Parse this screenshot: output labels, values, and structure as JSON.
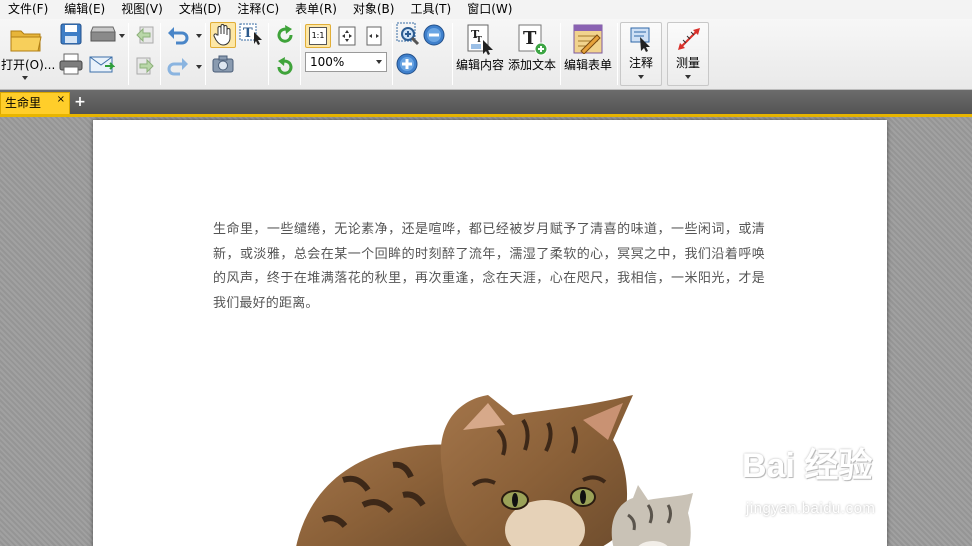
{
  "menu": [
    "文件(F)",
    "编辑(E)",
    "视图(V)",
    "文档(D)",
    "注释(C)",
    "表单(R)",
    "对象(B)",
    "工具(T)",
    "窗口(W)"
  ],
  "toolbar": {
    "open_label": "打开(O)...",
    "zoom_value": "100%",
    "actual_size_label": "1:1",
    "edit_content_label": "编辑内容",
    "add_text_label": "添加文本",
    "edit_form_label": "编辑表单",
    "annotate_label": "注释",
    "measure_label": "测量"
  },
  "tabs": {
    "doc_tab_label": "生命里",
    "close_glyph": "×",
    "add_glyph": "+"
  },
  "document": {
    "paragraph": "生命里，一些缱绻，无论素净，还是喧哗，都已经被岁月赋予了清喜的味道，一些闲词，或清新，或淡雅，总会在某一个回眸的时刻醉了流年，濡湿了柔软的心，冥冥之中，我们沿着呼唤的风声，终于在堆满落花的秋里，再次重逢，念在天涯，心在咫尺，我相信，一米阳光，才是我们最好的距离。"
  },
  "watermark": {
    "logo_text": "Bai 经验",
    "url": "jingyan.baidu.com"
  },
  "colors": {
    "accent_tab": "#ffce2a",
    "tab_bar": "#5f5f5f",
    "workspace": "#9b9b9b"
  },
  "icons": [
    "open-folder-icon",
    "save-icon",
    "scanner-icon",
    "print-icon",
    "email-icon",
    "prev-page-icon",
    "next-page-icon",
    "undo-icon",
    "redo-icon",
    "hand-tool-icon",
    "select-text-icon",
    "snapshot-icon",
    "rotate-cw-icon",
    "rotate-ccw-icon",
    "actual-size-icon",
    "fit-page-icon",
    "fit-width-icon",
    "zoom-in-tool-icon",
    "zoom-out-icon",
    "zoom-in-icon",
    "edit-content-icon",
    "add-text-icon",
    "edit-form-icon",
    "annotate-icon",
    "measure-icon"
  ]
}
